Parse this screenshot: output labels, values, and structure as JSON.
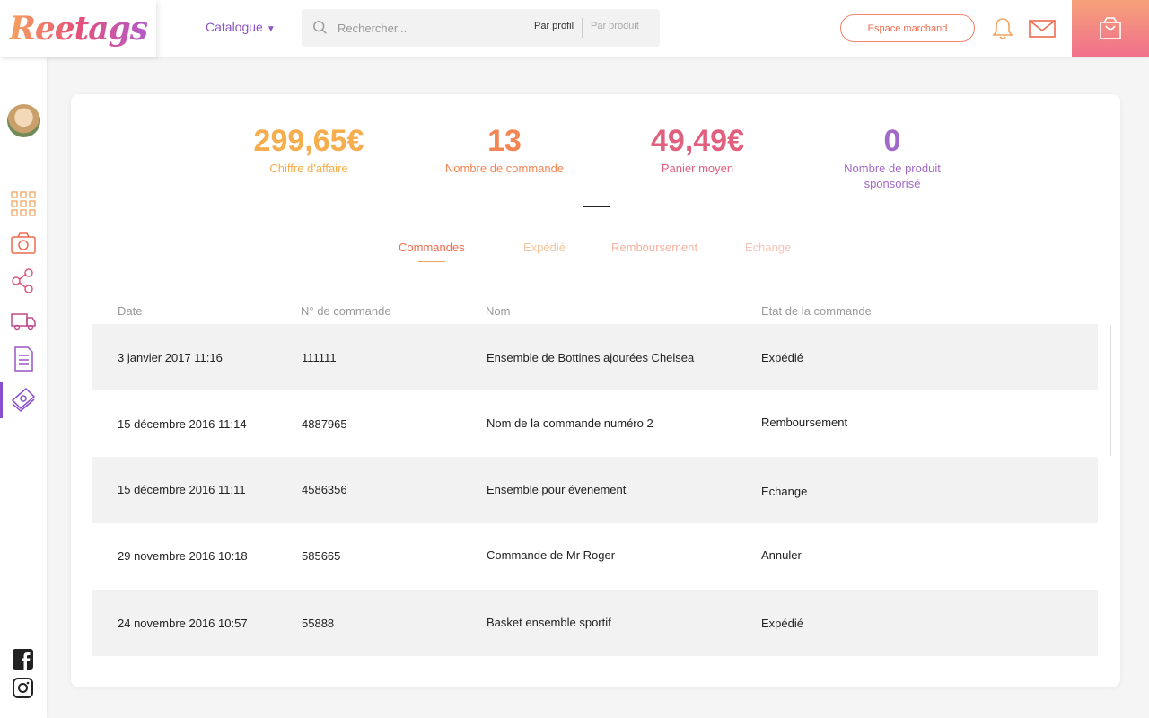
{
  "header": {
    "logo_text": "Reetags",
    "catalogue_label": "Catalogue",
    "search_placeholder": "Rechercher...",
    "search_option_profile": "Par profil",
    "search_option_product": "Par produit",
    "espace_button": "Espace marchand"
  },
  "stats": [
    {
      "value": "299,65€",
      "label": "Chiffre d'affaire",
      "color": "#f6ad4d"
    },
    {
      "value": "13",
      "label": "Nombre de commande",
      "color": "#f28655"
    },
    {
      "value": "49,49€",
      "label": "Panier moyen",
      "color": "#e0607e"
    },
    {
      "value": "0",
      "label": "Nombre de produit sponsorisé",
      "color": "#a26ac8"
    }
  ],
  "tabs": [
    {
      "label": "Commandes",
      "active": true
    },
    {
      "label": "Expédié",
      "active": false
    },
    {
      "label": "Remboursement",
      "active": false
    },
    {
      "label": "Echange",
      "active": false
    }
  ],
  "table": {
    "headers": [
      "Date",
      "N° de commande",
      "Nom",
      "Etat de la commande"
    ],
    "rows": [
      {
        "date": "3 janvier 2017 11:16",
        "number": "111111",
        "name": "Ensemble de Bottines ajourées Chelsea",
        "status": "Expédié"
      },
      {
        "date": "15 décembre  2016 11:14",
        "number": "4887965",
        "name": "Nom de la commande numéro 2",
        "status": "Remboursement"
      },
      {
        "date": "15 décembre 2016 11:11",
        "number": "4586356",
        "name": "Ensemble pour évenement",
        "status": "Echange"
      },
      {
        "date": "29 novembre 2016 10:18",
        "number": "585665",
        "name": "Commande de Mr Roger",
        "status": "Annuler"
      },
      {
        "date": "24 novembre 2016 10:57",
        "number": "55888",
        "name": "Basket ensemble sportif",
        "status": "Expédié"
      }
    ]
  },
  "colors": {
    "accent_orange": "#f0836a",
    "accent_purple": "#8a4fd0",
    "tab_active": "#ef6b4f",
    "tab_inactive": "#f4b3a0"
  }
}
